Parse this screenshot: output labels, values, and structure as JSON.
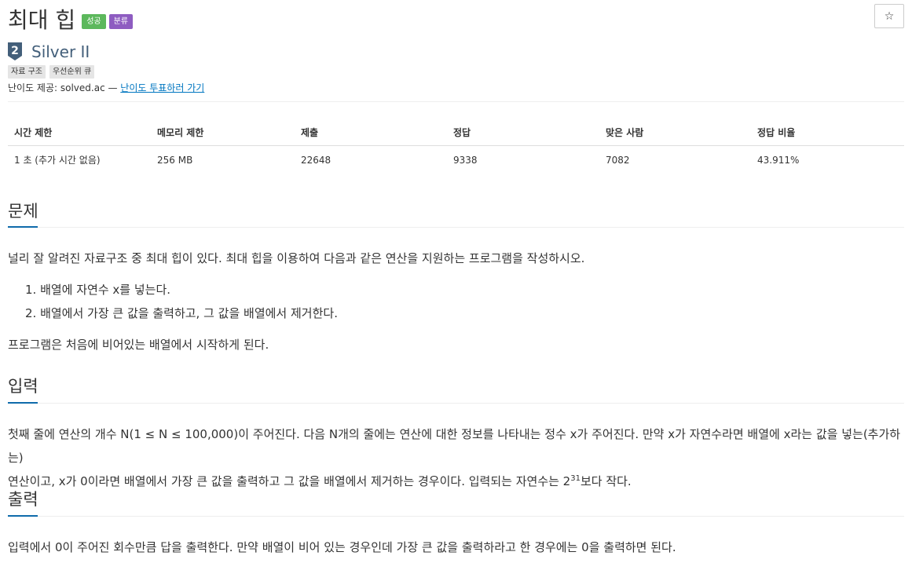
{
  "problem": {
    "title": "최대 힙",
    "badges": [
      "성공",
      "분류"
    ],
    "star": "☆"
  },
  "tier": {
    "level": "2",
    "name": "Silver II"
  },
  "tags": [
    "자료 구조",
    "우선순위 큐"
  ],
  "difficulty": {
    "prefix": "난이도 제공: solved.ac — ",
    "link": "난이도 투표하러 가기"
  },
  "info_table": {
    "headers": [
      "시간 제한",
      "메모리 제한",
      "제출",
      "정답",
      "맞은 사람",
      "정답 비율"
    ],
    "row": [
      "1 초 (추가 시간 없음)",
      "256 MB",
      "22648",
      "9338",
      "7082",
      "43.911%"
    ]
  },
  "sections": {
    "problem": {
      "title": "문제",
      "intro": "널리 잘 알려진 자료구조 중 최대 힙이 있다. 최대 힙을 이용하여 다음과 같은 연산을 지원하는 프로그램을 작성하시오.",
      "items": [
        "1. 배열에 자연수 x를 넣는다.",
        "2. 배열에서 가장 큰 값을 출력하고, 그 값을 배열에서 제거한다."
      ],
      "outro": "프로그램은 처음에 비어있는 배열에서 시작하게 된다."
    },
    "input": {
      "title": "입력",
      "line1": "첫째 줄에 연산의 개수 N(1 ≤ N ≤ 100,000)이 주어진다. 다음 N개의 줄에는 연산에 대한 정보를 나타내는 정수 x가 주어진다. 만약 x가 자연수라면 배열에 x라는 값을 넣는(추가하는)",
      "line2_a": "연산이고, x가 0이라면 배열에서 가장 큰 값을 출력하고 그 값을 배열에서 제거하는 경우이다. 입력되는 자연수는 2",
      "line2_sup": "31",
      "line2_b": "보다 작다."
    },
    "output": {
      "title": "출력",
      "text": "입력에서 0이 주어진 회수만큼 답을 출력한다. 만약 배열이 비어 있는 경우인데 가장 큰 값을 출력하라고 한 경우에는 0을 출력하면 된다."
    }
  },
  "colors": {
    "success_badge": "#5cb85c",
    "tag_badge": "#8e5cc1",
    "tier_silver": "#435f7a",
    "link": "#0076c0",
    "section_underline": "#0f6bab"
  }
}
